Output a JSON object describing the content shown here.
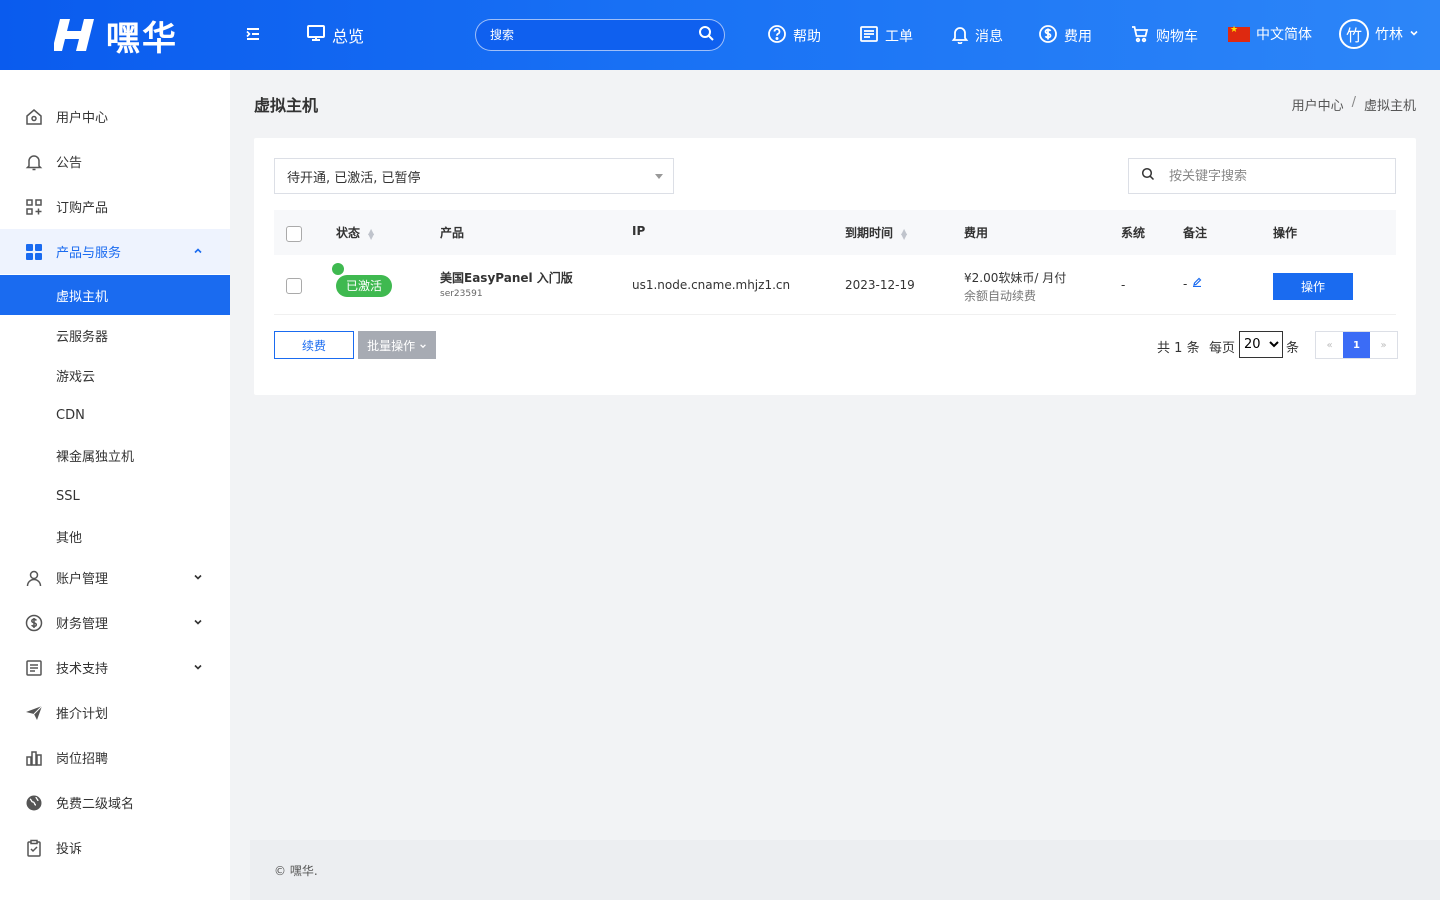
{
  "header": {
    "logo_text": "嘿华",
    "overview": "总览",
    "search_placeholder": "搜索",
    "help": "帮助",
    "ticket": "工单",
    "messages": "消息",
    "fees": "费用",
    "cart": "购物车",
    "language": "中文简体",
    "avatar_char": "竹",
    "username": "竹林"
  },
  "sidebar": {
    "items": [
      {
        "label": "用户中心",
        "icon": "home-icon"
      },
      {
        "label": "公告",
        "icon": "bell-icon"
      },
      {
        "label": "订购产品",
        "icon": "grid-plus-icon"
      },
      {
        "label": "产品与服务",
        "icon": "apps-icon"
      },
      {
        "label": "账户管理",
        "icon": "user-icon"
      },
      {
        "label": "财务管理",
        "icon": "dollar-circle-icon"
      },
      {
        "label": "技术支持",
        "icon": "document-icon"
      },
      {
        "label": "推介计划",
        "icon": "send-icon"
      },
      {
        "label": "岗位招聘",
        "icon": "bar-chart-icon"
      },
      {
        "label": "免费二级域名",
        "icon": "globe-icon"
      },
      {
        "label": "投诉",
        "icon": "clipboard-check-icon"
      }
    ],
    "sub_items": [
      "虚拟主机",
      "云服务器",
      "游戏云",
      "CDN",
      "裸金属独立机",
      "SSL",
      "其他"
    ]
  },
  "page": {
    "title": "虚拟主机",
    "breadcrumb": [
      "用户中心",
      "/",
      "虚拟主机"
    ]
  },
  "filter": {
    "status_value": "待开通, 已激活, 已暂停",
    "keyword_placeholder": "按关键字搜索"
  },
  "table": {
    "columns": [
      "状态",
      "产品",
      "IP",
      "到期时间",
      "费用",
      "系统",
      "备注",
      "操作"
    ],
    "rows": [
      {
        "status": "已激活",
        "product": "美国EasyPanel 入门版",
        "product_id": "ser23591",
        "ip": "us1.node.cname.mhjz1.cn",
        "expire": "2023-12-19",
        "fee": "¥2.00软妹币/ 月付",
        "fee_note": "余额自动续费",
        "system": "-",
        "remark": "-",
        "action": "操作"
      }
    ]
  },
  "actions": {
    "renew": "续费",
    "batch": "批量操作"
  },
  "pagination": {
    "total_prefix": "共",
    "total_count": "1",
    "total_suffix": "条",
    "per_page_label": "每页",
    "per_page": "20",
    "per_page_suffix": "条",
    "prev": "«",
    "current": "1",
    "next": "»"
  },
  "footer": {
    "copyright": "© 嘿华."
  },
  "colors": {
    "brand": "#1a6bf0",
    "active_badge": "#3fb950"
  }
}
